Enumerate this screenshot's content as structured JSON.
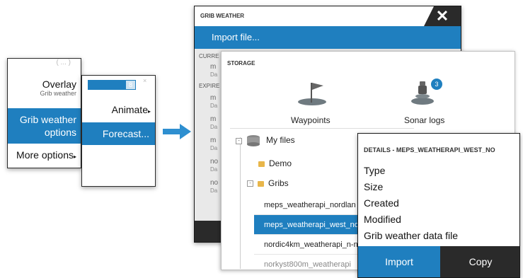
{
  "menu_a": {
    "faded_top": "( ... )",
    "overlay_label": "Overlay",
    "overlay_sub": "Grib weather",
    "grib_line1": "Grib weather",
    "grib_line2": "options",
    "more_options": "More options"
  },
  "menu_b": {
    "slider_value": "8",
    "slider_fraction": 0.8,
    "animate": "Animate",
    "forecast": "Forecast..."
  },
  "grib_dialog": {
    "title": "GRIB WEATHER",
    "close_glyph": "✕",
    "import_file": "Import file...",
    "section_current": "CURRE",
    "section_expired": "EXPIRE",
    "rows": [
      {
        "name": "m",
        "sub": "Da"
      },
      {
        "name": "m",
        "sub": "Da"
      },
      {
        "name": "m",
        "sub": "Da"
      },
      {
        "name": "m",
        "sub": "Da"
      },
      {
        "name": "no",
        "sub": "Da"
      },
      {
        "name": "no",
        "sub": "Da"
      }
    ]
  },
  "storage": {
    "title": "STORAGE",
    "waypoints": "Waypoints",
    "sonar_logs": "Sonar logs",
    "sonar_badge": "3",
    "my_files": "My files",
    "demo": "Demo",
    "gribs": "Gribs",
    "files": [
      "meps_weatherapi_nordlan",
      "meps_weatherapi_west_no",
      "nordic4km_weatherapi_n-n",
      "norkyst800m_weatherapi"
    ]
  },
  "details": {
    "title": "DETAILS - MEPS_WEATHERAPI_WEST_NO",
    "type": "Type",
    "size": "Size",
    "created": "Created",
    "modified": "Modified",
    "file_type": "Grib weather data file",
    "import": "Import",
    "copy": "Copy"
  },
  "colors": {
    "accent": "#1f7fbf",
    "dark": "#2a2a2a",
    "folder": "#e8b64a"
  }
}
